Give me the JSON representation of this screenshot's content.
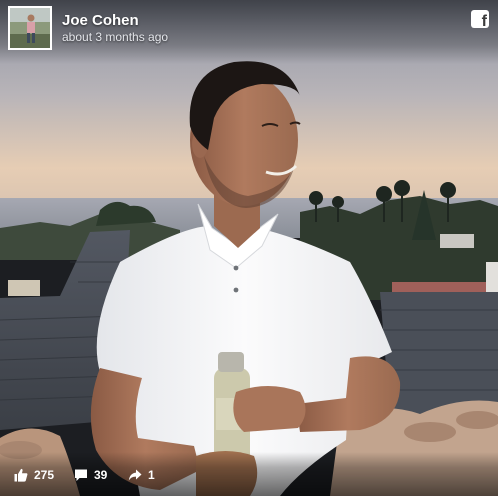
{
  "post": {
    "author": "Joe Cohen",
    "timestamp": "about 3 months ago",
    "platform_icon": "facebook-icon",
    "stats": {
      "likes": "275",
      "comments": "39",
      "shares": "1"
    },
    "icons": {
      "likes": "thumbs-up-icon",
      "comments": "comment-bubble-icon",
      "shares": "share-arrow-icon"
    }
  },
  "colors": {
    "sky_top": "#9aa0b0",
    "sky_horizon": "#e2c9b0",
    "shirt": "#f4f4f4",
    "roof": "#4a4f58",
    "tile": "#b99a84"
  }
}
